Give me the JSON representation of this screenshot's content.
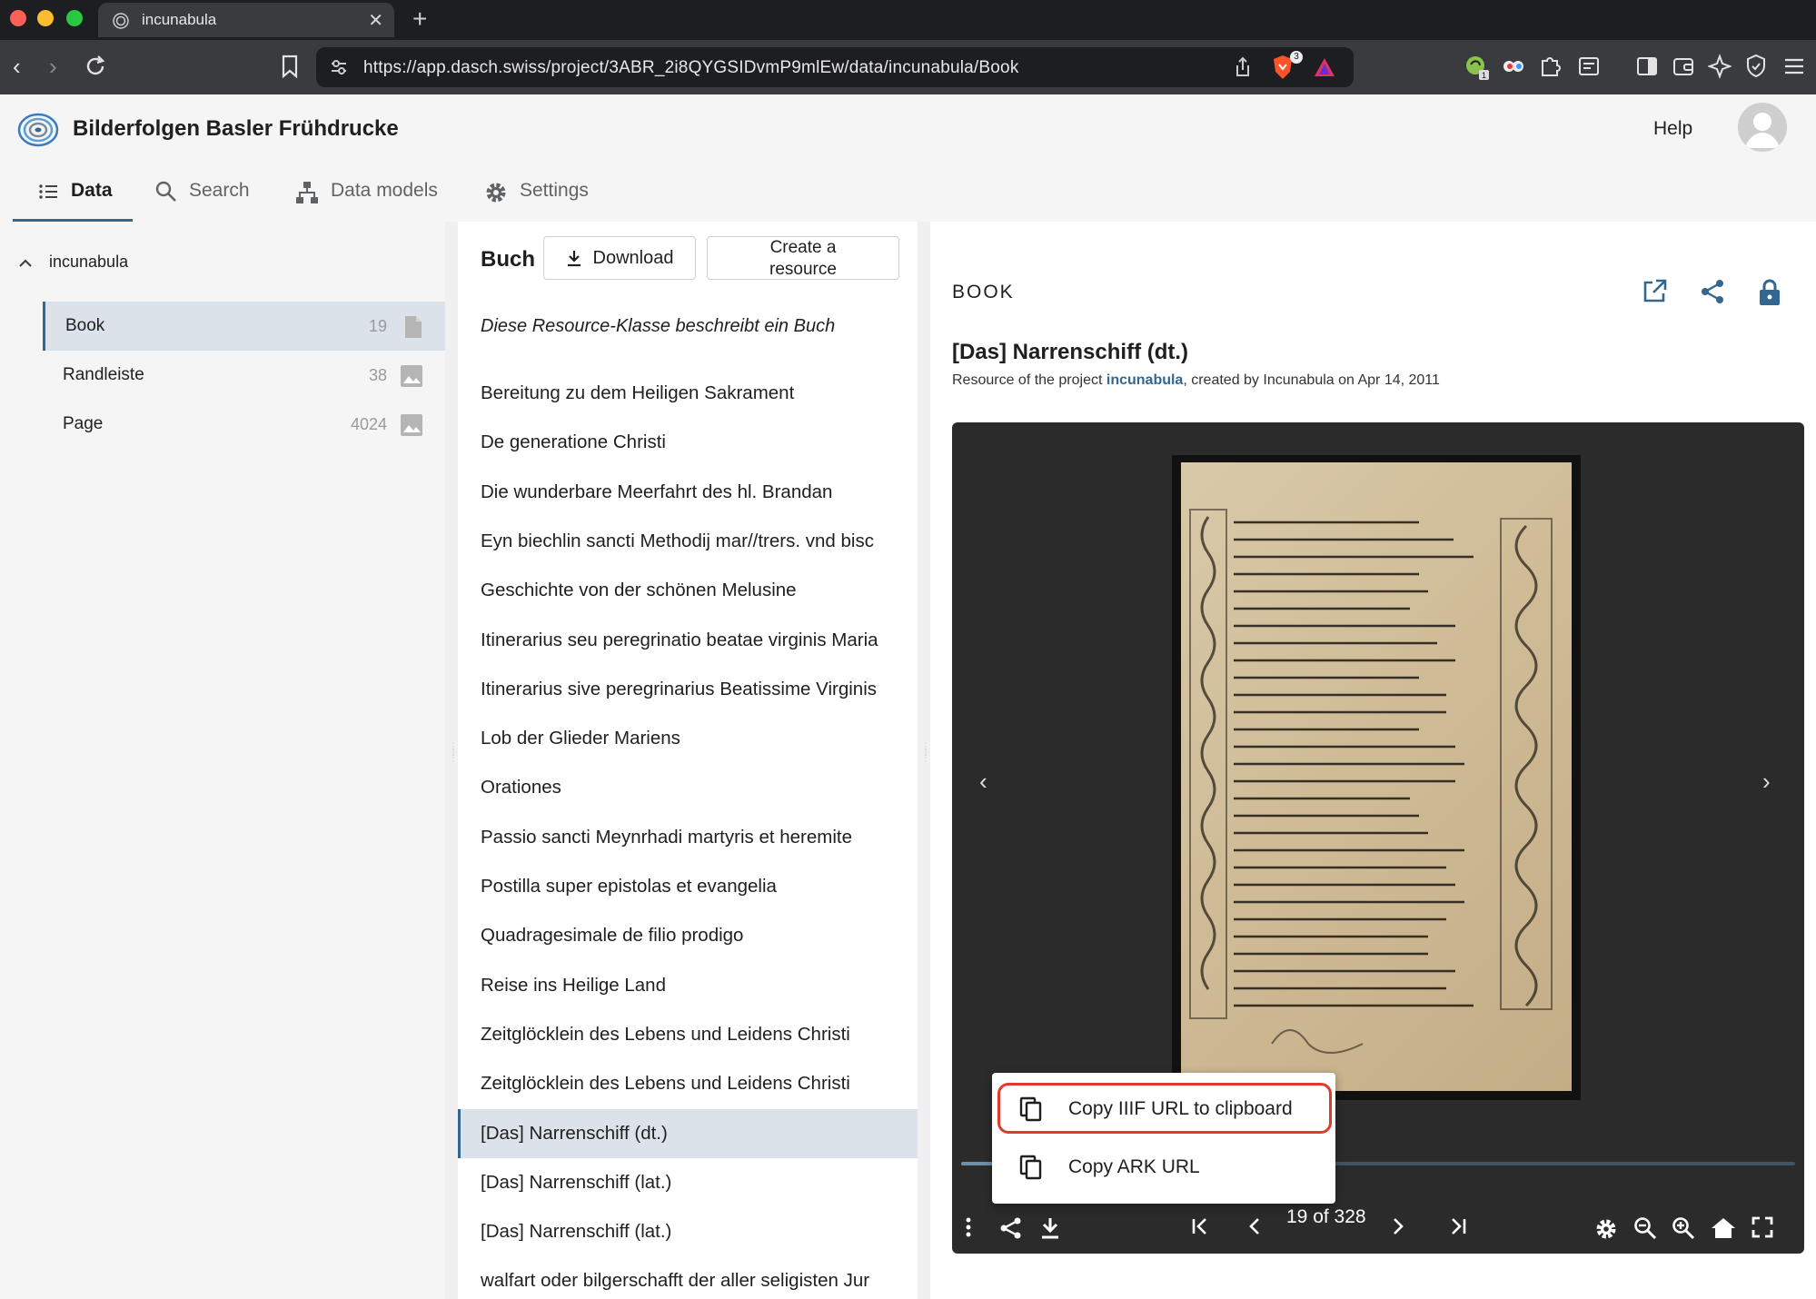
{
  "browser": {
    "tab_title": "incunabula",
    "url": "https://app.dasch.swiss/project/3ABR_2i8QYGSIDvmP9mlEw/data/incunabula/Book",
    "shields_count": "3",
    "ext_badge": "1"
  },
  "app": {
    "title": "Bilderfolgen Basler Frühdrucke",
    "help": "Help",
    "nav": [
      {
        "label": "Data"
      },
      {
        "label": "Search"
      },
      {
        "label": "Data models"
      },
      {
        "label": "Settings"
      }
    ]
  },
  "sidebar": {
    "ontology": "incunabula",
    "items": [
      {
        "label": "Book",
        "count": "19",
        "icon": "document-icon"
      },
      {
        "label": "Randleiste",
        "count": "38",
        "icon": "image-icon"
      },
      {
        "label": "Page",
        "count": "4024",
        "icon": "image-icon"
      }
    ]
  },
  "list": {
    "title": "Buch",
    "download": "Download",
    "create": "Create a resource",
    "description": "Diese Resource-Klasse beschreibt ein Buch",
    "items": [
      "Bereitung zu dem Heiligen Sakrament",
      "De generatione Christi",
      "Die wunderbare Meerfahrt des hl. Brandan",
      "Eyn biechlin sancti Methodij mar//trers. vnd bisc",
      "Geschichte von der schönen Melusine",
      "Itinerarius seu peregrinatio beatae virginis Maria",
      "Itinerarius sive peregrinarius Beatissime Virginis",
      "Lob der Glieder Mariens",
      "Orationes",
      "Passio sancti Meynrhadi martyris et heremite",
      "Postilla super epistolas et evangelia",
      "Quadragesimale de filio prodigo",
      "Reise ins Heilige Land",
      "Zeitglöcklein des Lebens und Leidens Christi",
      "Zeitglöcklein des Lebens und Leidens Christi",
      "[Das] Narrenschiff (dt.)",
      "[Das] Narrenschiff (lat.)",
      "[Das] Narrenschiff (lat.)",
      "walfart oder bilgerschafft der aller seligisten Jur"
    ],
    "selected_index": 15
  },
  "detail": {
    "kind": "BOOK",
    "title": "[Das] Narrenschiff (dt.)",
    "meta_prefix": "Resource of the project ",
    "meta_project": "incunabula",
    "meta_suffix": ", created by Incunabula on Apr 14, 2011",
    "viewer": {
      "current_page": 19,
      "total_pages": 328,
      "pager_label": "19 of 328",
      "progress": 0.058
    },
    "menu": {
      "copy_iiif": "Copy IIIF URL to clipboard",
      "copy_ark": "Copy ARK URL"
    }
  },
  "colors": {
    "accent": "#336790",
    "highlight": "#e03a2a",
    "selected_bg": "#dce2e9"
  }
}
